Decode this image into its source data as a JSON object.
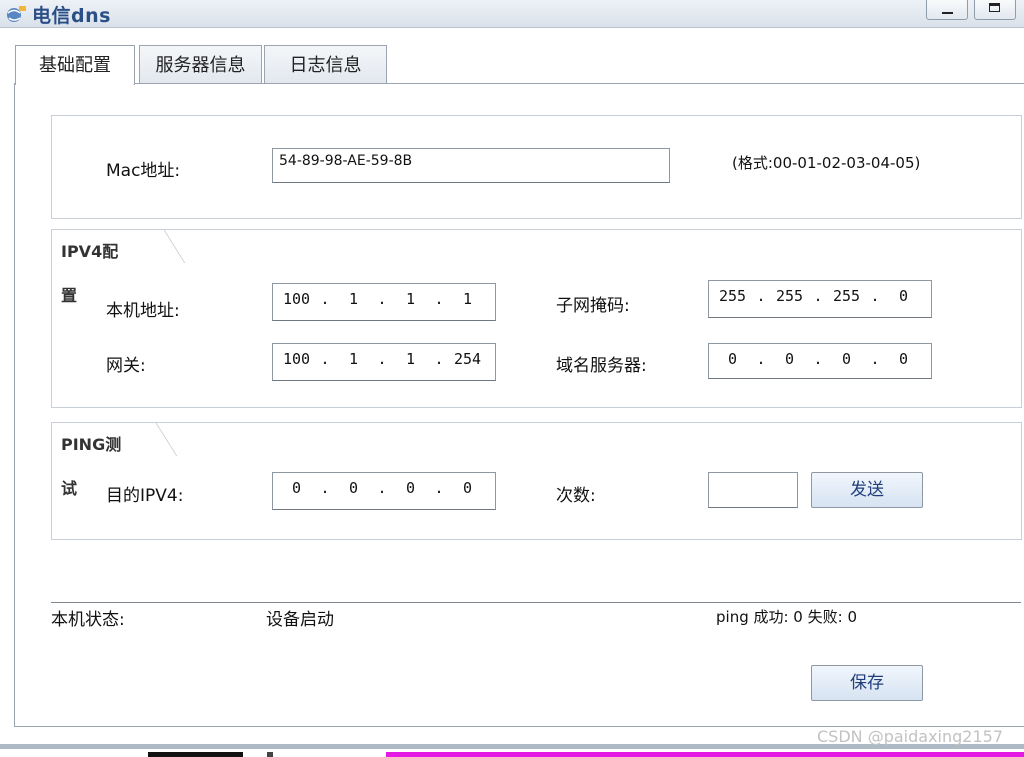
{
  "window": {
    "title": "电信dns"
  },
  "tabs": [
    {
      "label": "基础配置",
      "active": true
    },
    {
      "label": "服务器信息",
      "active": false
    },
    {
      "label": "日志信息",
      "active": false
    }
  ],
  "mac": {
    "label": "Mac地址:",
    "value": "54-89-98-AE-59-8B",
    "hint": "(格式:00-01-02-03-04-05)"
  },
  "ipv4": {
    "legend": "IPV4配置",
    "local_label": "本机地址:",
    "local": [
      "100",
      "1",
      "1",
      "1"
    ],
    "mask_label": "子网掩码:",
    "mask": [
      "255",
      "255",
      "255",
      "0"
    ],
    "gateway_label": "网关:",
    "gateway": [
      "100",
      "1",
      "1",
      "254"
    ],
    "dns_label": "域名服务器:",
    "dns": [
      "0",
      "0",
      "0",
      "0"
    ]
  },
  "ping": {
    "legend": "PING测试",
    "target_label": "目的IPV4:",
    "target": [
      "0",
      "0",
      "0",
      "0"
    ],
    "count_label": "次数:",
    "count_value": "",
    "send_label": "发送"
  },
  "status": {
    "label": "本机状态:",
    "value": "设备启动",
    "ping_result": "ping 成功: 0 失败: 0"
  },
  "save_label": "保存",
  "watermark": "CSDN @paidaxing2157",
  "colors": {
    "title": "#2a4f86",
    "button_text": "#1f3e7a",
    "strip_pink": "#e419e4"
  }
}
